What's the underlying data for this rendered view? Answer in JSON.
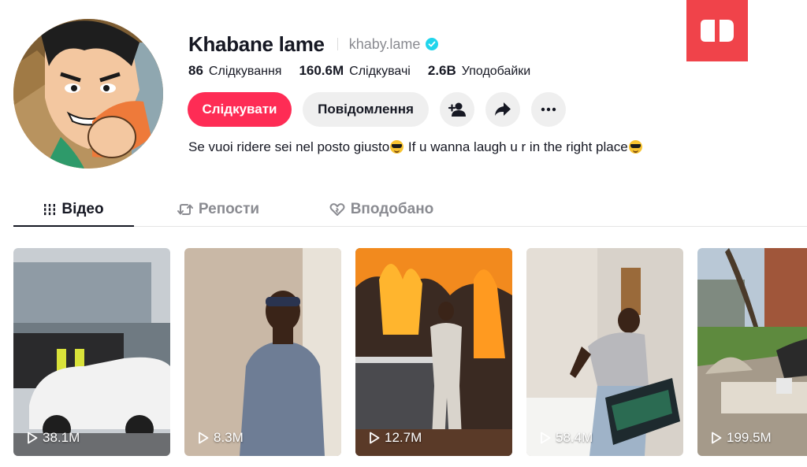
{
  "profile": {
    "display_name": "Khabane lame",
    "username": "khaby.lame",
    "verified": true,
    "bio_parts": [
      "Se vuoi ridere sei nel posto giusto",
      " If u wanna laugh u r in the right place"
    ],
    "bio_emoji": "smiling-face-with-sunglasses"
  },
  "stats": [
    {
      "value": "86",
      "label": "Слідкування"
    },
    {
      "value": "160.6M",
      "label": "Слідкувачі"
    },
    {
      "value": "2.6B",
      "label": "Уподобайки"
    }
  ],
  "actions": {
    "follow_label": "Слідкувати",
    "message_label": "Повідомлення",
    "icons": [
      "add-friend-icon",
      "share-icon",
      "more-icon"
    ]
  },
  "tabs": [
    {
      "label": "Відео",
      "icon": "grid-icon",
      "active": true
    },
    {
      "label": "Репости",
      "icon": "repost-icon",
      "active": false
    },
    {
      "label": "Вподобано",
      "icon": "liked-icon",
      "active": false
    }
  ],
  "videos": [
    {
      "views": "38.1M"
    },
    {
      "views": "8.3M"
    },
    {
      "views": "12.7M"
    },
    {
      "views": "58.4M"
    },
    {
      "views": "199.5M"
    }
  ],
  "colors": {
    "accent": "#fe2c55",
    "verified": "#20d5ec",
    "badge": "#f0434a"
  }
}
